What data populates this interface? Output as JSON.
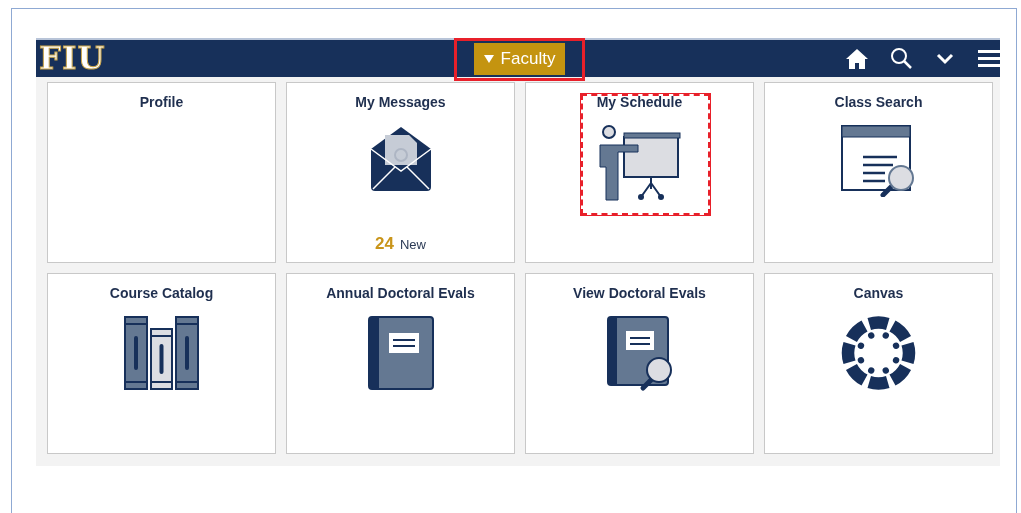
{
  "header": {
    "logo": "FIU",
    "role_menu": {
      "label": "Faculty",
      "highlighted": true
    }
  },
  "tiles": [
    {
      "title": "Profile",
      "highlighted": false
    },
    {
      "title": "My Messages",
      "highlighted": false,
      "count": "24",
      "count_label": "New"
    },
    {
      "title": "My Schedule",
      "highlighted": true
    },
    {
      "title": "Class Search",
      "highlighted": false
    },
    {
      "title": "Course Catalog",
      "highlighted": false
    },
    {
      "title": "Annual Doctoral Evals",
      "highlighted": false
    },
    {
      "title": "View Doctoral Evals",
      "highlighted": false
    },
    {
      "title": "Canvas",
      "highlighted": false
    }
  ]
}
